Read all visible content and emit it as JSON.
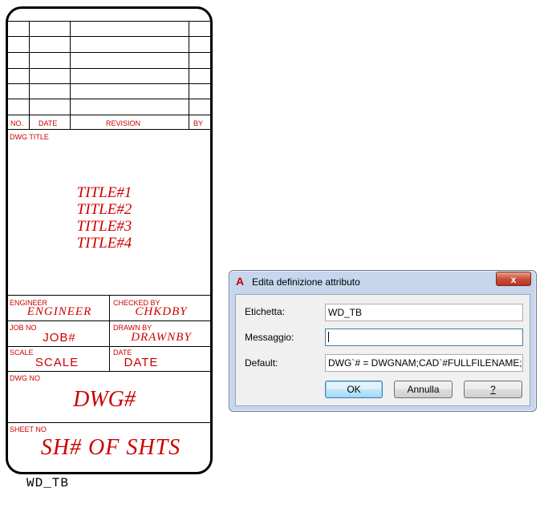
{
  "title_block": {
    "revision_headers": {
      "no": "NO.",
      "date": "DATE",
      "revision": "REVISION",
      "by": "BY"
    },
    "dwg_title_label": "DWG TITLE",
    "titles": [
      "TITLE#1",
      "TITLE#2",
      "TITLE#3",
      "TITLE#4"
    ],
    "engineer_label": "ENGINEER",
    "engineer_value": "ENGINEER",
    "checked_by_label": "CHECKED BY",
    "checked_by_value": "CHKDBY",
    "job_no_label": "JOB NO",
    "job_no_value": "JOB#",
    "drawn_by_label": "DRAWN BY",
    "drawn_by_value": "DRAWNBY",
    "scale_label": "SCALE",
    "scale_value": "SCALE",
    "date_label": "DATE",
    "date_value": "DATE",
    "dwg_no_label": "DWG NO",
    "dwg_no_value": "DWG#",
    "sheet_no_label": "SHEET NO",
    "sheet_no_value": "SH# OF SHTS",
    "block_name": "WD_TB"
  },
  "dialog": {
    "title": "Edita definizione attributo",
    "app_icon": "autocad-icon",
    "close_glyph": "x",
    "fields": {
      "tag_label": "Etichetta:",
      "tag_value": "WD_TB",
      "prompt_label": "Messaggio:",
      "prompt_value": "",
      "default_label": "Default:",
      "default_value": "DWG`# = DWGNAM;CAD`#FULLFILENAME;SH"
    },
    "buttons": {
      "ok": "OK",
      "cancel": "Annulla",
      "help": "?"
    }
  },
  "colors": {
    "cad_text": "#cc0000",
    "dialog_frame": "#c6d6ec",
    "close_button": "#c9503b"
  }
}
